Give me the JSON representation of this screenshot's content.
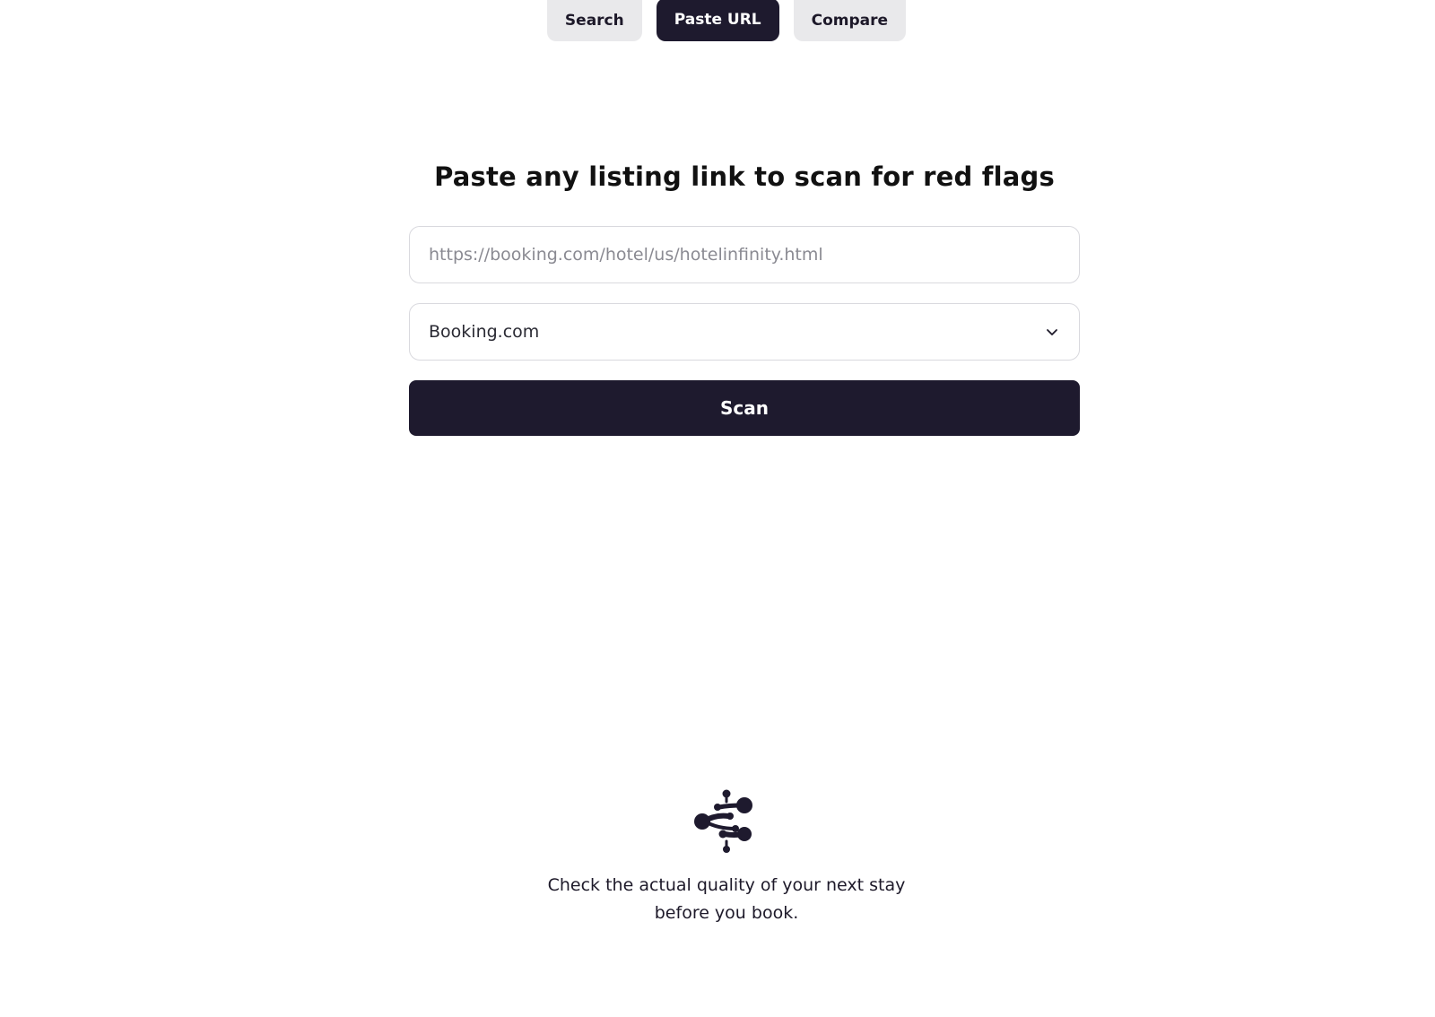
{
  "tabs": [
    {
      "label": "Search",
      "active": false
    },
    {
      "label": "Paste URL",
      "active": true
    },
    {
      "label": "Compare",
      "active": false
    }
  ],
  "main": {
    "heading": "Paste any listing link to scan for red flags",
    "url_input": {
      "value": "",
      "placeholder": "https://booking.com/hotel/us/hotelinfinity.html"
    },
    "platform_select": {
      "selected": "Booking.com"
    },
    "scan_label": "Scan"
  },
  "footer": {
    "logo_icon": "molecule-logo-icon",
    "tagline_line1": "Check the actual quality of your next stay",
    "tagline_line2": "before you book."
  },
  "colors": {
    "primary": "#1e1a2e",
    "tab_inactive": "#e9e9eb",
    "border": "#d9d9de",
    "background": "#ffffff"
  }
}
